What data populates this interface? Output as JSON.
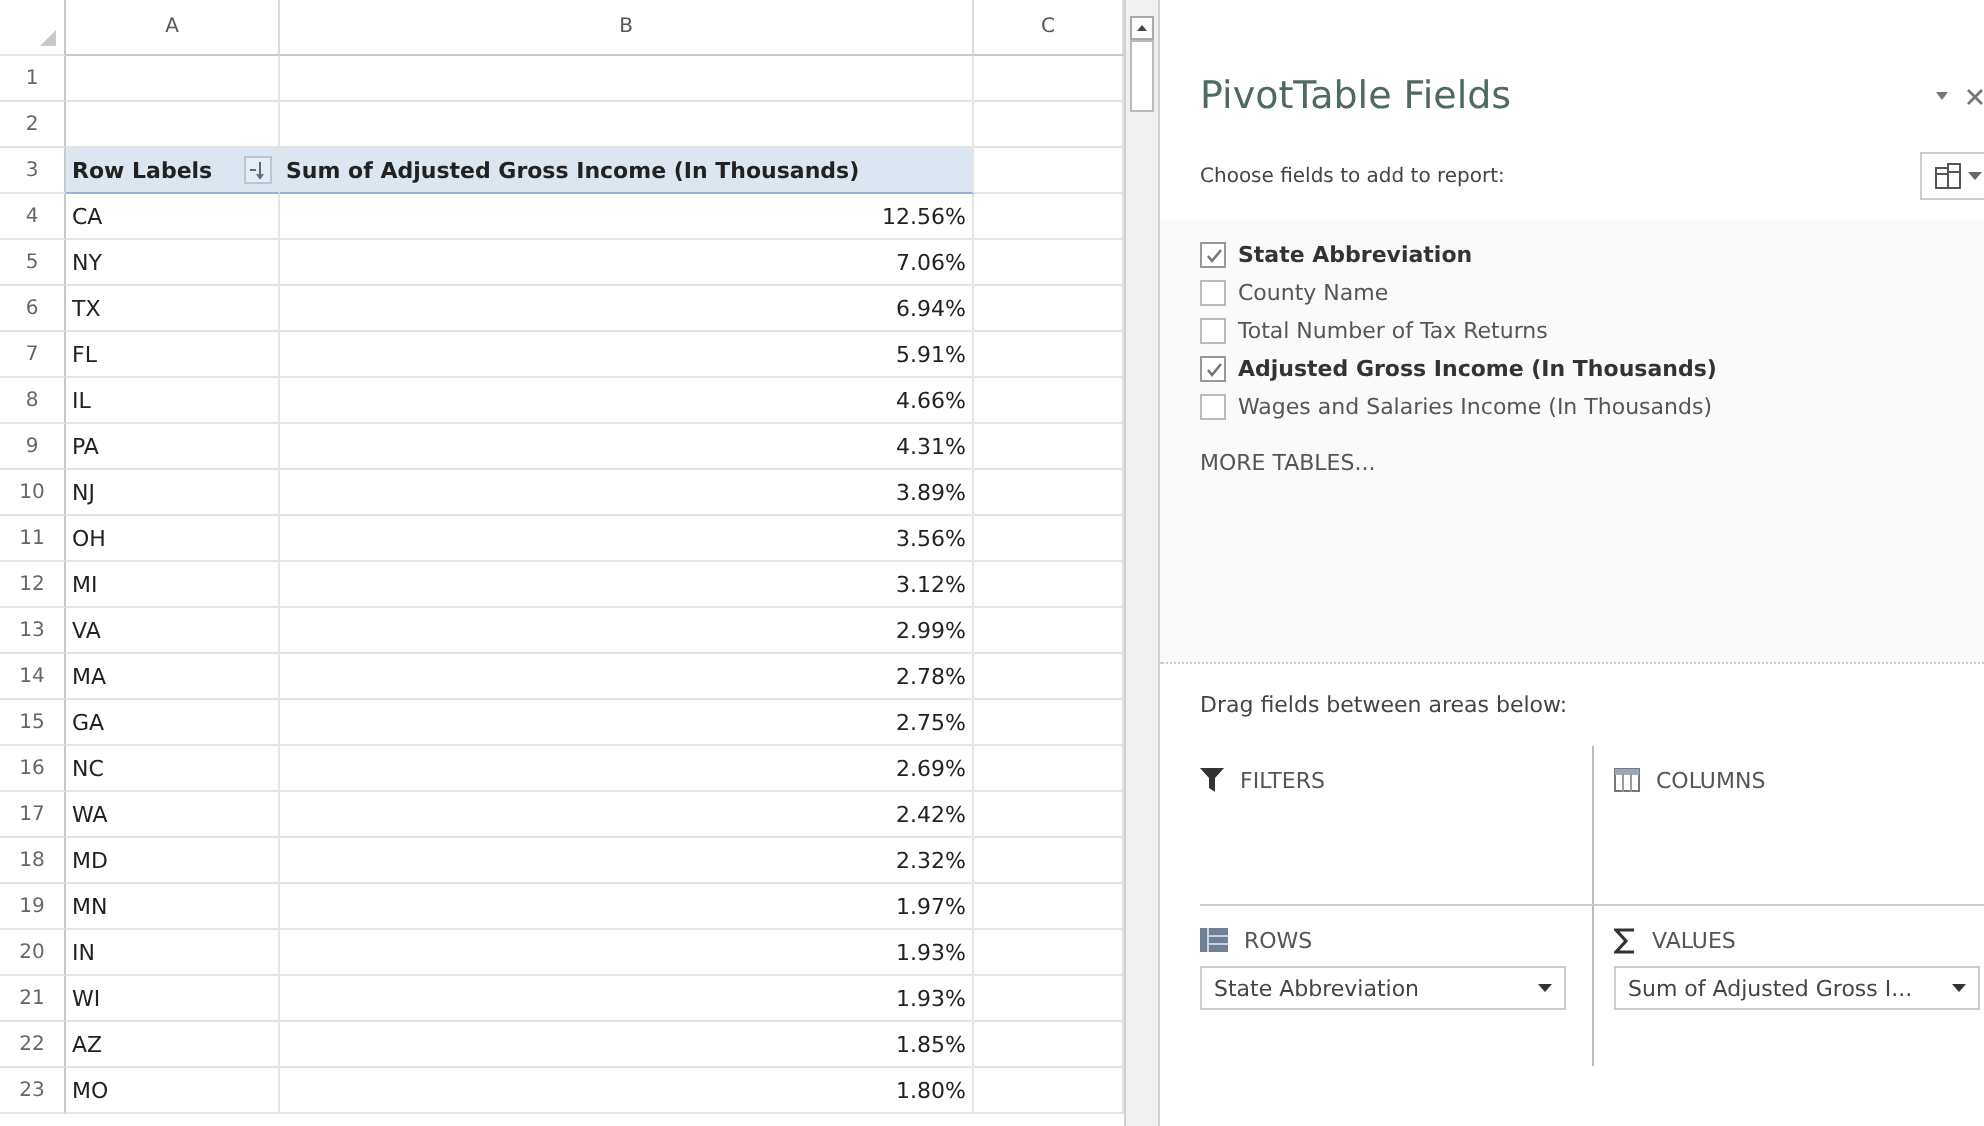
{
  "sheet": {
    "columns": [
      "A",
      "B",
      "C"
    ],
    "rows": [
      {
        "number": "1",
        "kind": "blank"
      },
      {
        "number": "2",
        "kind": "blank"
      },
      {
        "number": "3",
        "kind": "header",
        "label": "Row Labels",
        "value": "Sum of Adjusted Gross Income (In Thousands)"
      },
      {
        "number": "4",
        "kind": "data",
        "label": "CA",
        "value": "12.56%"
      },
      {
        "number": "5",
        "kind": "data",
        "label": "NY",
        "value": "7.06%"
      },
      {
        "number": "6",
        "kind": "data",
        "label": "TX",
        "value": "6.94%"
      },
      {
        "number": "7",
        "kind": "data",
        "label": "FL",
        "value": "5.91%"
      },
      {
        "number": "8",
        "kind": "data",
        "label": "IL",
        "value": "4.66%"
      },
      {
        "number": "9",
        "kind": "data",
        "label": "PA",
        "value": "4.31%"
      },
      {
        "number": "10",
        "kind": "data",
        "label": "NJ",
        "value": "3.89%"
      },
      {
        "number": "11",
        "kind": "data",
        "label": "OH",
        "value": "3.56%"
      },
      {
        "number": "12",
        "kind": "data",
        "label": "MI",
        "value": "3.12%"
      },
      {
        "number": "13",
        "kind": "data",
        "label": "VA",
        "value": "2.99%"
      },
      {
        "number": "14",
        "kind": "data",
        "label": "MA",
        "value": "2.78%"
      },
      {
        "number": "15",
        "kind": "data",
        "label": "GA",
        "value": "2.75%"
      },
      {
        "number": "16",
        "kind": "data",
        "label": "NC",
        "value": "2.69%"
      },
      {
        "number": "17",
        "kind": "data",
        "label": "WA",
        "value": "2.42%"
      },
      {
        "number": "18",
        "kind": "data",
        "label": "MD",
        "value": "2.32%"
      },
      {
        "number": "19",
        "kind": "data",
        "label": "MN",
        "value": "1.97%"
      },
      {
        "number": "20",
        "kind": "data",
        "label": "IN",
        "value": "1.93%"
      },
      {
        "number": "21",
        "kind": "data",
        "label": "WI",
        "value": "1.93%"
      },
      {
        "number": "22",
        "kind": "data",
        "label": "AZ",
        "value": "1.85%"
      },
      {
        "number": "23",
        "kind": "data",
        "label": "MO",
        "value": "1.80%"
      }
    ]
  },
  "pane": {
    "title": "PivotTable Fields",
    "subtitle": "Choose fields to add to report:",
    "fields": [
      {
        "label": "State Abbreviation",
        "checked": true
      },
      {
        "label": "County Name",
        "checked": false
      },
      {
        "label": "Total Number of Tax Returns",
        "checked": false
      },
      {
        "label": "Adjusted Gross Income (In Thousands)",
        "checked": true
      },
      {
        "label": "Wages and Salaries Income (In Thousands)",
        "checked": false
      }
    ],
    "more_tables": "MORE TABLES...",
    "areas_hint": "Drag fields between areas below:",
    "areas": [
      {
        "kind": "filters",
        "title": "FILTERS"
      },
      {
        "kind": "columns",
        "title": "COLUMNS"
      },
      {
        "kind": "rows",
        "title": "ROWS",
        "chip": "State Abbreviation"
      },
      {
        "kind": "values",
        "title": "VALUES",
        "chip": "Sum of Adjusted Gross I..."
      }
    ]
  }
}
